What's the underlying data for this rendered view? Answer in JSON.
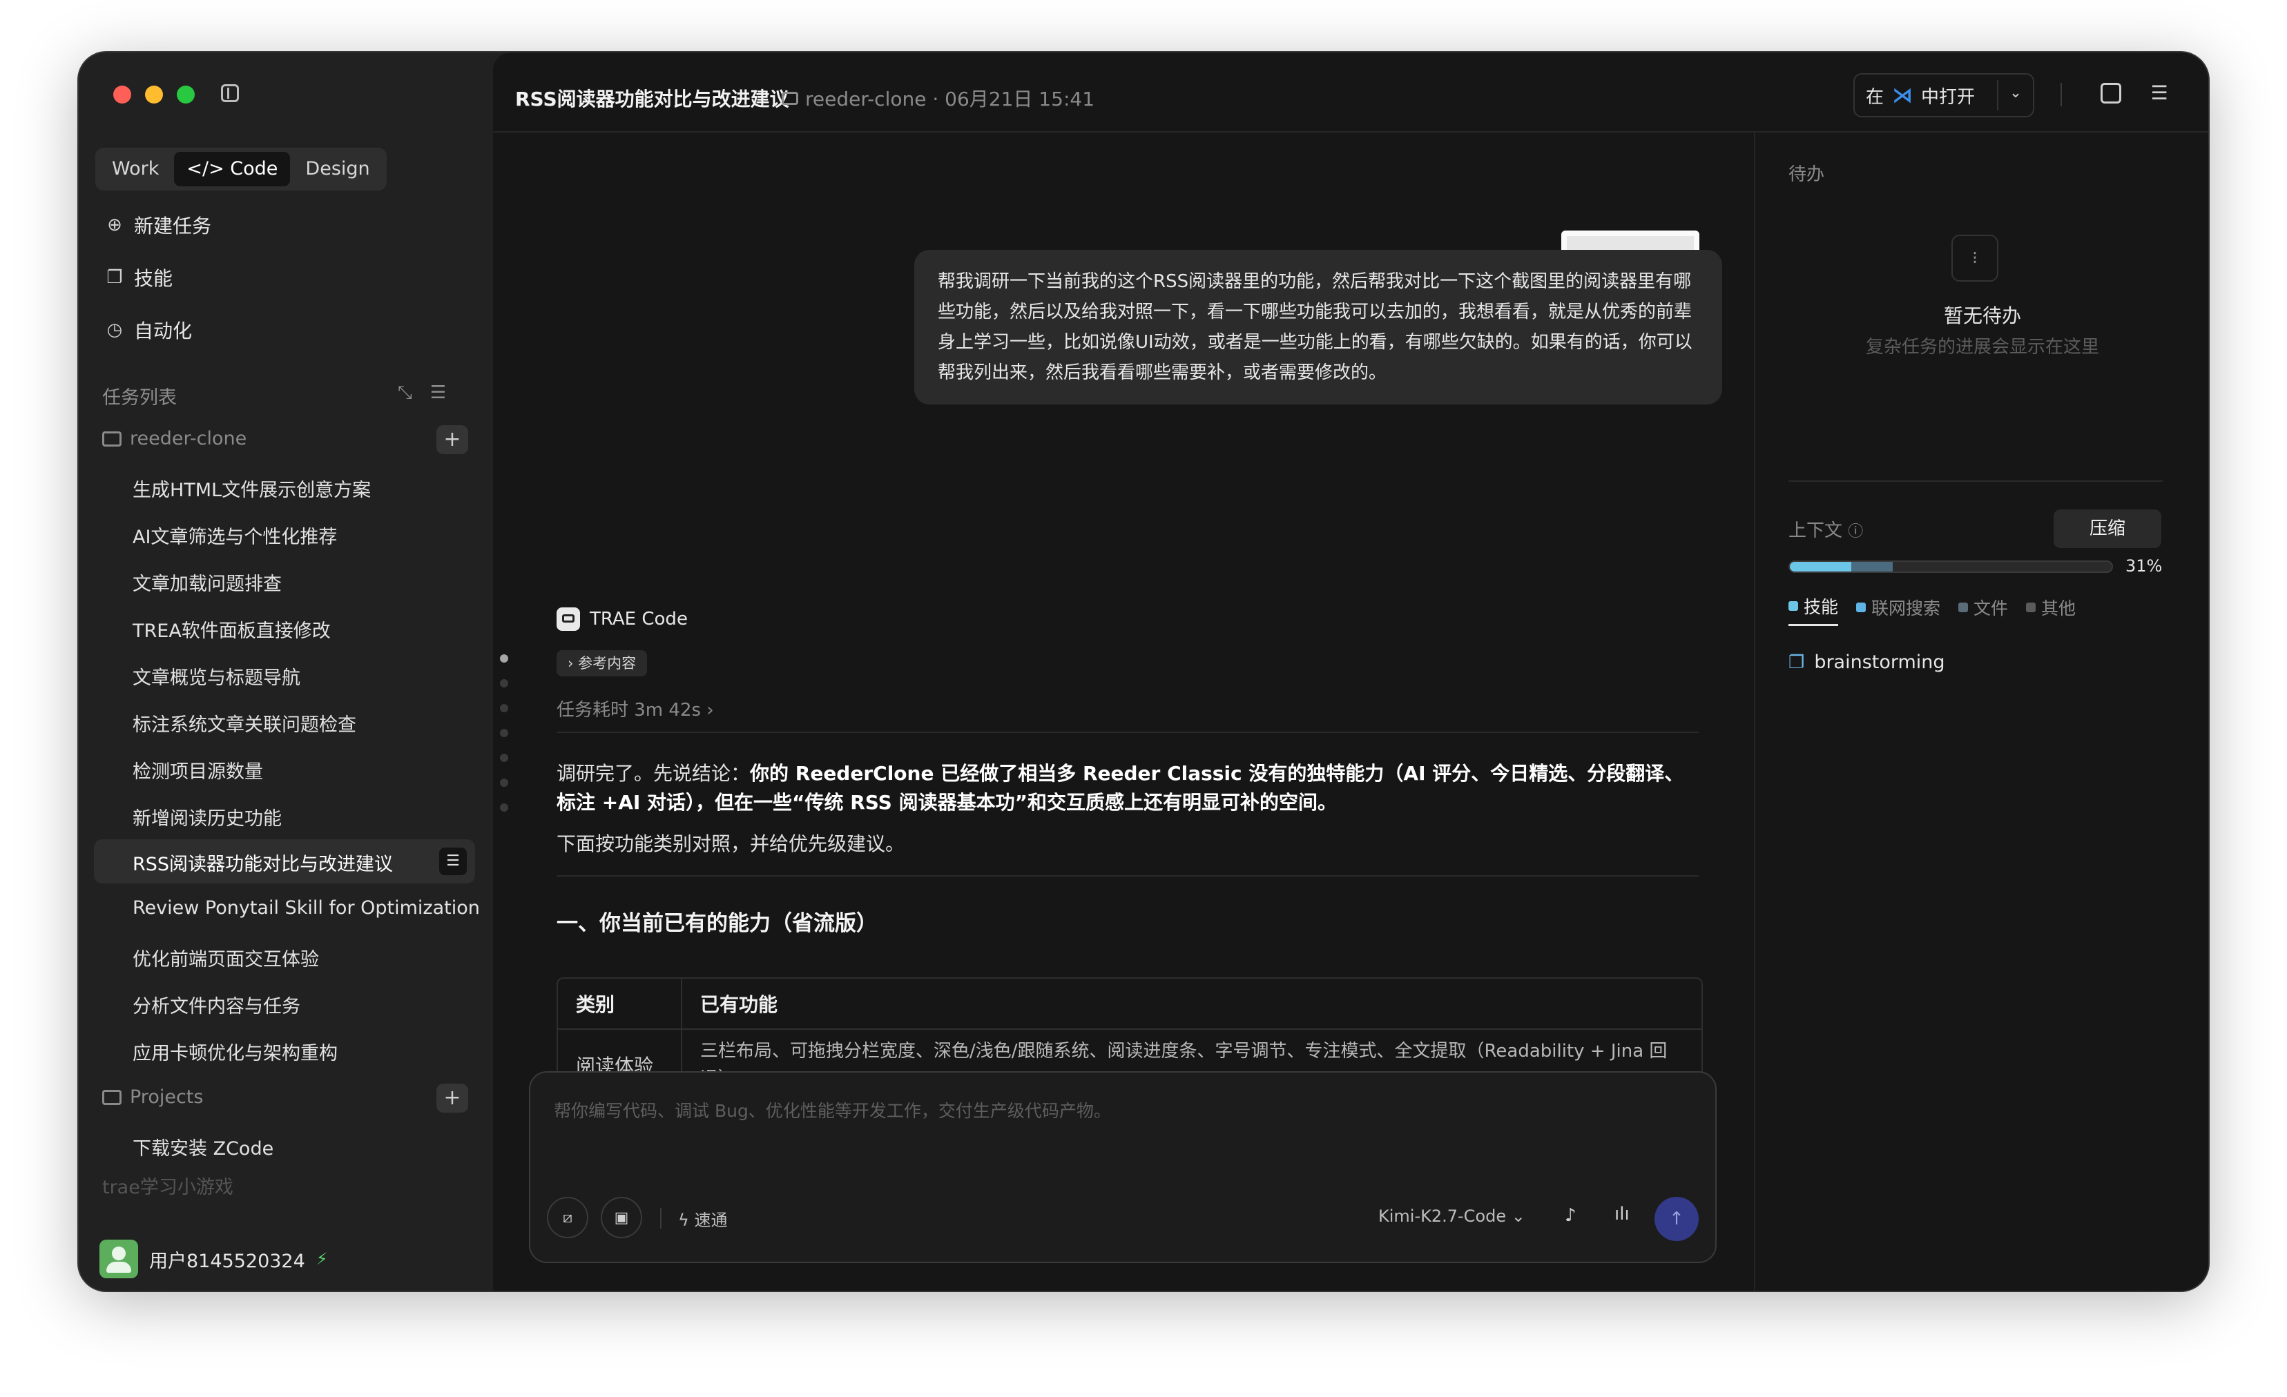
{
  "sidebar": {
    "segments": [
      "Work",
      "</> Code",
      "Design"
    ],
    "nav": [
      {
        "label": "新建任务",
        "icon": "new-task-icon"
      },
      {
        "label": "技能",
        "icon": "book-icon"
      },
      {
        "label": "自动化",
        "icon": "clock-icon"
      }
    ],
    "section_title": "任务列表",
    "folders": [
      {
        "name": "reeder-clone",
        "tasks": [
          "生成HTML文件展示创意方案",
          "AI文章筛选与个性化推荐",
          "文章加载问题排查",
          "TREA软件面板直接修改",
          "文章概览与标题导航",
          "标注系统文章关联问题检查",
          "检测项目源数量",
          "新增阅读历史功能",
          "RSS阅读器功能对比与改进建议",
          "Review Ponytail Skill for Optimization",
          "优化前端页面交互体验",
          "分析文件内容与任务",
          "应用卡顿优化与架构重构"
        ]
      },
      {
        "name": "Projects",
        "tasks": [
          "下载安装 ZCode"
        ]
      },
      {
        "name": "trae学习小游戏",
        "tasks": []
      }
    ],
    "user": "用户8145520324"
  },
  "topbar": {
    "title": "RSS阅读器功能对比与改进建议",
    "meta": "reeder-clone · 06月21日 15:41",
    "open_prefix": "在",
    "open_suffix": "中打开"
  },
  "chat": {
    "user_message": "帮我调研一下当前我的这个RSS阅读器里的功能，然后帮我对比一下这个截图里的阅读器里有哪些功能，然后以及给我对照一下，看一下哪些功能我可以去加的，我想看看，就是从优秀的前辈身上学习一些，比如说像UI动效，或者是一些功能上的看，有哪些欠缺的。如果有的话，你可以帮我列出来，然后我看看哪些需要补，或者需要修改的。",
    "agent_name": "TRAE Code",
    "ref_chip": "参考内容",
    "duration": "任务耗时 3m 42s",
    "p1_prefix": "调研完了。先说结论：",
    "p1_bold": "你的 ReederClone 已经做了相当多 Reeder Classic 没有的独特能力（AI 评分、今日精选、分段翻译、标注 +AI 对话），但在一些“传统 RSS 阅读器基本功”和交互质感上还有明显可补的空间。",
    "p2": "下面按功能类别对照，并给优先级建议。",
    "h2": "一、你当前已有的能力（省流版）",
    "table": {
      "headers": [
        "类别",
        "已有功能"
      ],
      "rows": [
        [
          "阅读体验",
          "三栏布局、可拖拽分栏宽度、深色/浅色/跟随系统、阅读进度条、字号调节、专注模式、全文提取（Readability + Jina 回退）"
        ]
      ]
    }
  },
  "composer": {
    "placeholder": "帮你编写代码、调试 Bug、优化性能等开发工作，交付生产级代码产物。",
    "speed": "速通",
    "model": "Kimi-K2.7-Code"
  },
  "right_panel": {
    "todo_title": "待办",
    "todo_empty": "暂无待办",
    "todo_hint": "复杂任务的进展会显示在这里",
    "context_label": "上下文",
    "compress": "压缩",
    "percent": "31%",
    "usage": {
      "skills": 0.19,
      "other": 0.13
    },
    "legend": [
      {
        "label": "技能",
        "color": "#6cc6e8"
      },
      {
        "label": "联网搜索",
        "color": "#5fb4e6"
      },
      {
        "label": "文件",
        "color": "#5b6b78"
      },
      {
        "label": "其他",
        "color": "#5b5b5b"
      }
    ],
    "skill": "brainstorming"
  }
}
